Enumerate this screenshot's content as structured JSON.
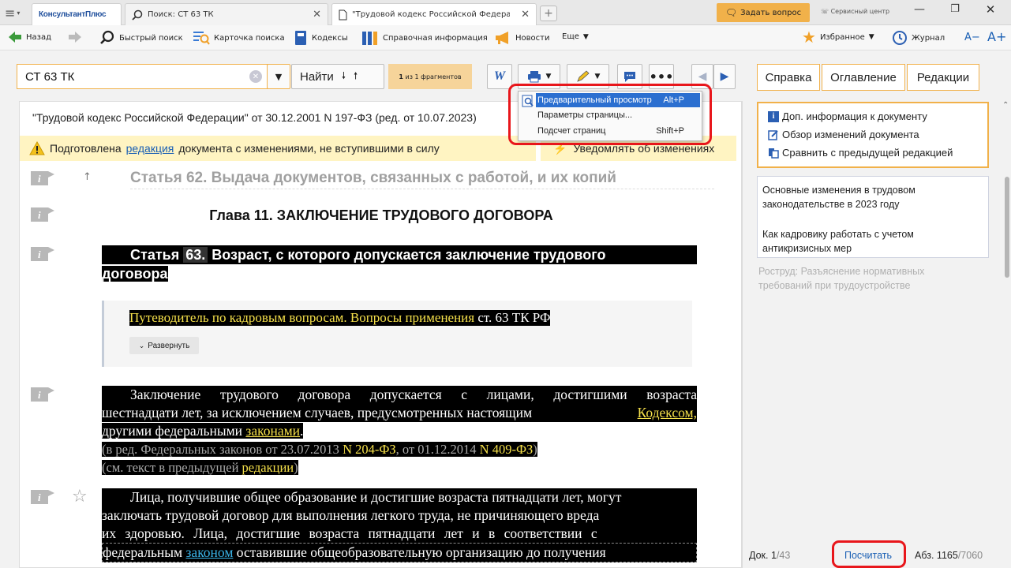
{
  "titlebar": {
    "menu_glyph": "≡",
    "brand": "КонсультантПлюс",
    "tabs": [
      {
        "label": "Поиск: СТ 63 ТК"
      },
      {
        "label": "\"Трудовой кодекс Российской Федерации\""
      }
    ],
    "ask_button": "Задать вопрос",
    "service_center": "Сервисный центр"
  },
  "navbar": {
    "back": "Назад",
    "quick_search": "Быстрый поиск",
    "search_card": "Карточка поиска",
    "codes": "Кодексы",
    "reference": "Справочная информация",
    "news": "Новости",
    "more": "Еще",
    "favorites": "Избранное",
    "journal": "Журнал",
    "font_smaller": "A−",
    "font_larger": "A+"
  },
  "search": {
    "query": "СТ 63 ТК",
    "find_label": "Найти",
    "fragments_count": "1",
    "fragments_text": "из 1 фрагментов"
  },
  "menu": {
    "items": [
      {
        "label": "Предварительный просмотр",
        "shortcut": "Alt+P"
      },
      {
        "label": "Параметры страницы...",
        "shortcut": ""
      },
      {
        "label": "Подсчет страниц",
        "shortcut": "Shift+P"
      }
    ]
  },
  "document": {
    "header": "\"Трудовой кодекс Российской Федерации\" от 30.12.2001 N 197-ФЗ (ред. от 10.07.2023)",
    "notice_prefix": "Подготовлена",
    "notice_link": "редакция",
    "notice_suffix": "документа с изменениями, не вступившими в силу",
    "notify_label": "Уведомлять об изменениях",
    "prev_article": "Статья 62. Выдача документов, связанных с работой, и их копий",
    "chapter": "Глава 11. ЗАКЛЮЧЕНИЕ ТРУДОВОГО ДОГОВОРА",
    "article_word": "Статья",
    "article_number": "63.",
    "article_title_rest": "Возраст, с которого допускается заключение трудового",
    "article_title_line2": "договора",
    "guide_text": "Путеводитель по кадровым вопросам. Вопросы применения",
    "guide_ref": "ст. 63 ТК РФ",
    "expand_label": "Развернуть",
    "para1_line1": "Заключение трудового договора допускается с лицами, достигшими возраста",
    "para1_line2_a": "шестнадцати лет, за исключением случаев, предусмотренных настоящим",
    "para1_link1": "Кодексом,",
    "para1_line3_a": "другими федеральными",
    "para1_link2": "законами",
    "para1_end": ".",
    "para1_ed_a": "(в ред. Федеральных законов от 23.07.2013",
    "para1_ed_link1": "N 204-ФЗ",
    "para1_ed_b": ", от 01.12.2014",
    "para1_ed_link2": "N 409-ФЗ",
    "para1_ed_c": ")",
    "para1_see_a": "(см. текст в предыдущей",
    "para1_see_link": "редакции",
    "para1_see_c": ")",
    "para2_line1": "Лица, получившие общее образование и достигшие возраста пятнадцати лет, могут",
    "para2_line2": "заключать трудовой договор для выполнения легкого труда, не причиняющего вреда",
    "para2_line3": "их здоровью. Лица, достигшие возраста пятнадцати лет и в соответствии с",
    "para2_line4_a": "федеральным",
    "para2_line4_link": "законом",
    "para2_line4_b": "оставившие общеобразовательную организацию до получения"
  },
  "rightpanel": {
    "tabs": [
      "Справка",
      "Оглавление",
      "Редакции"
    ],
    "links": [
      "Доп. информация к документу",
      "Обзор изменений документа",
      "Сравнить с предыдущей редакцией"
    ],
    "related": [
      "Основные изменения в трудовом законодательстве в 2023 году",
      "Как кадровику работать с учетом антикризисных мер",
      "Роструд: Разъяснение нормативных требований при трудоустройстве"
    ]
  },
  "statusbar": {
    "doc_label": "Док.",
    "doc_current": "1",
    "doc_total": "/43",
    "count_button": "Посчитать",
    "para_label": "Абз.",
    "para_current": "1165",
    "para_total": "/7060"
  },
  "colors": {
    "brand": "#1f4f9c",
    "accent_orange": "#f1b14a",
    "notice_yellow": "#fff4c2",
    "marker_gray": "#b8b8b8",
    "highlight_red": "#e8161b",
    "link_blue": "#1a5fb4",
    "yellow_link": "#f5e04a"
  }
}
